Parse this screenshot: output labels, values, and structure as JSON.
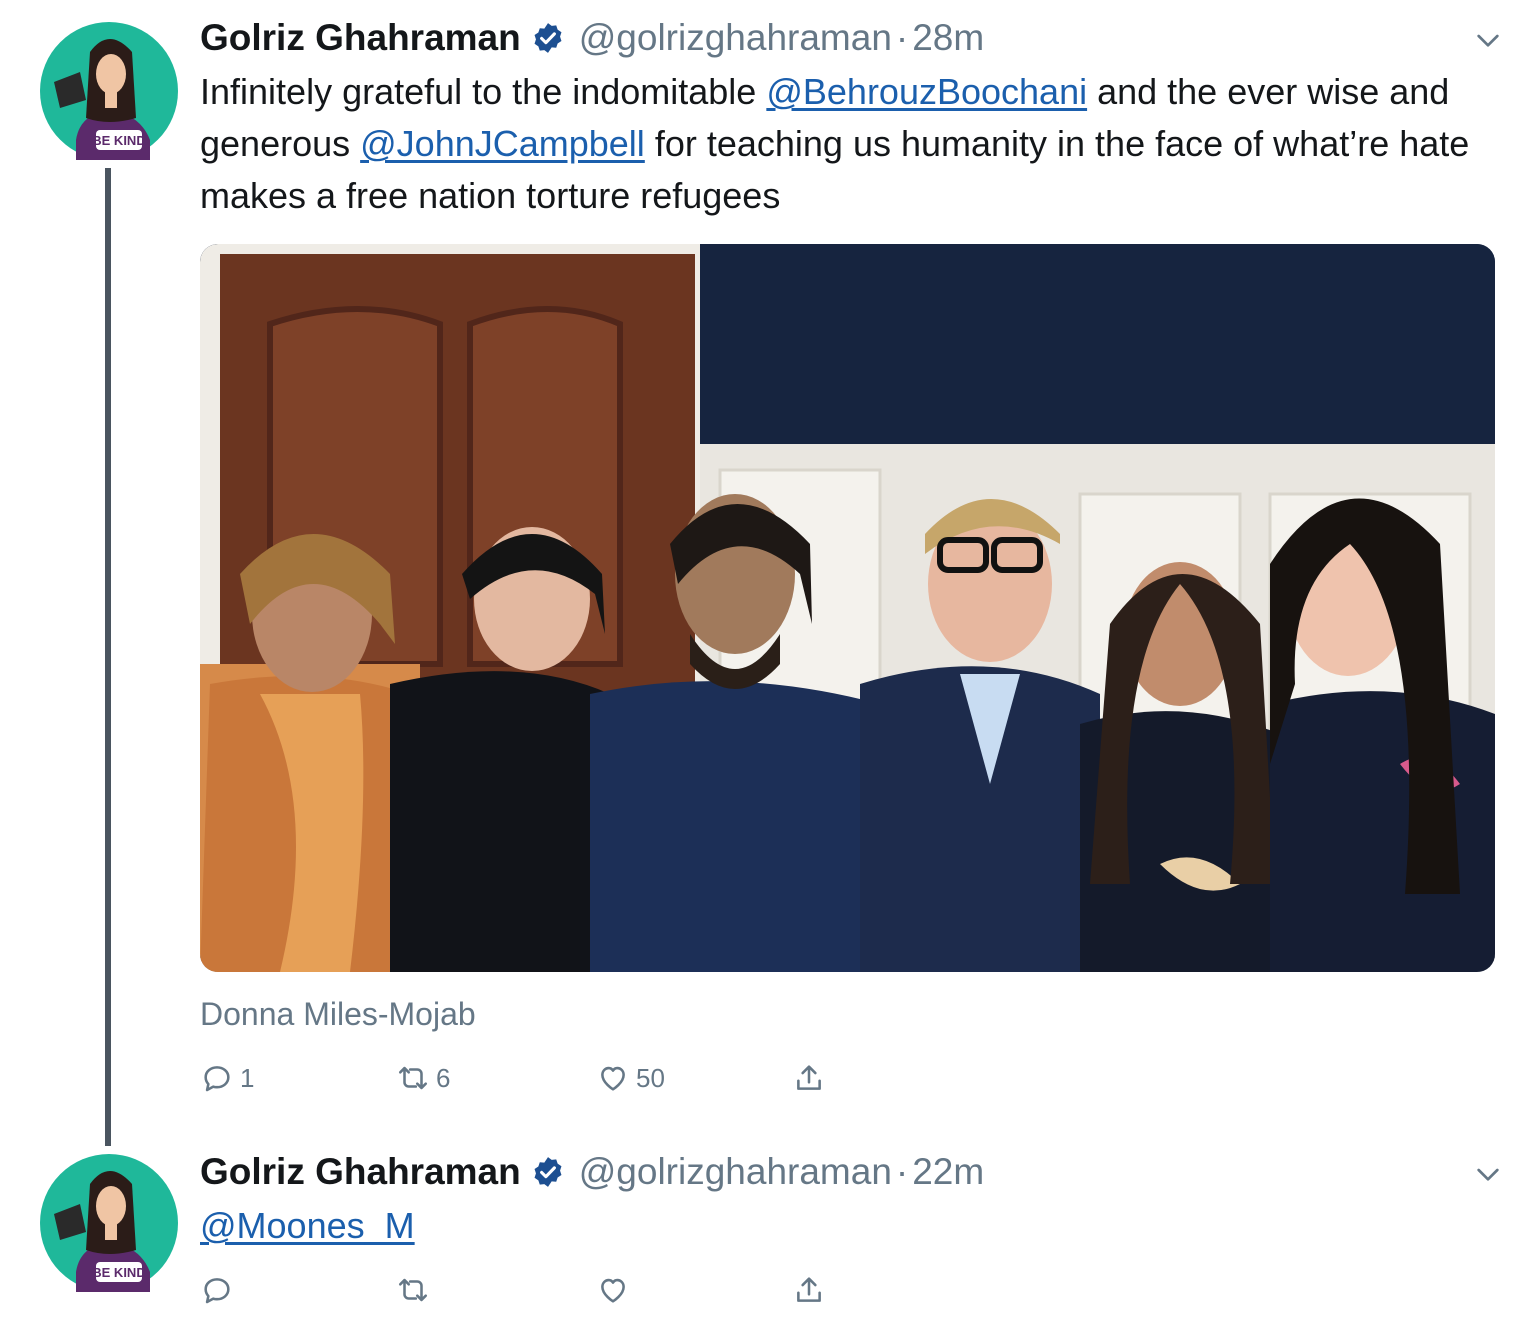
{
  "tweets": [
    {
      "author": {
        "name": "Golriz Ghahraman",
        "handle": "@golrizghahraman",
        "avatar_badge": "BE KIND"
      },
      "time": "28m",
      "text": {
        "before1": "Infinitely grateful to the indomitable ",
        "mention1": "@BehrouzBoochani",
        "mid1": " and the ever wise and generous ",
        "mention2": "@JohnJCampbell",
        "after": " for teaching us humanity in the face of what’re hate makes a free nation torture refugees"
      },
      "photo_caption": "Donna Miles-Mojab",
      "counts": {
        "replies": "1",
        "retweets": "6",
        "likes": "50"
      }
    },
    {
      "author": {
        "name": "Golriz Ghahraman",
        "handle": "@golrizghahraman",
        "avatar_badge": "BE KIND"
      },
      "time": "22m",
      "text": {
        "mention1": "@Moones_M"
      },
      "counts": {
        "replies": "",
        "retweets": "",
        "likes": ""
      }
    }
  ],
  "icons": {
    "verified": "verified-badge-icon",
    "chevron": "chevron-down-icon",
    "reply": "reply-icon",
    "retweet": "retweet-icon",
    "like": "heart-icon",
    "share": "share-icon"
  },
  "colors": {
    "link": "#1b5fad",
    "muted": "#657786",
    "verified": "#1d4f91",
    "avatar_bg": "#1fb89a",
    "shirt": "#5b2a6b"
  }
}
